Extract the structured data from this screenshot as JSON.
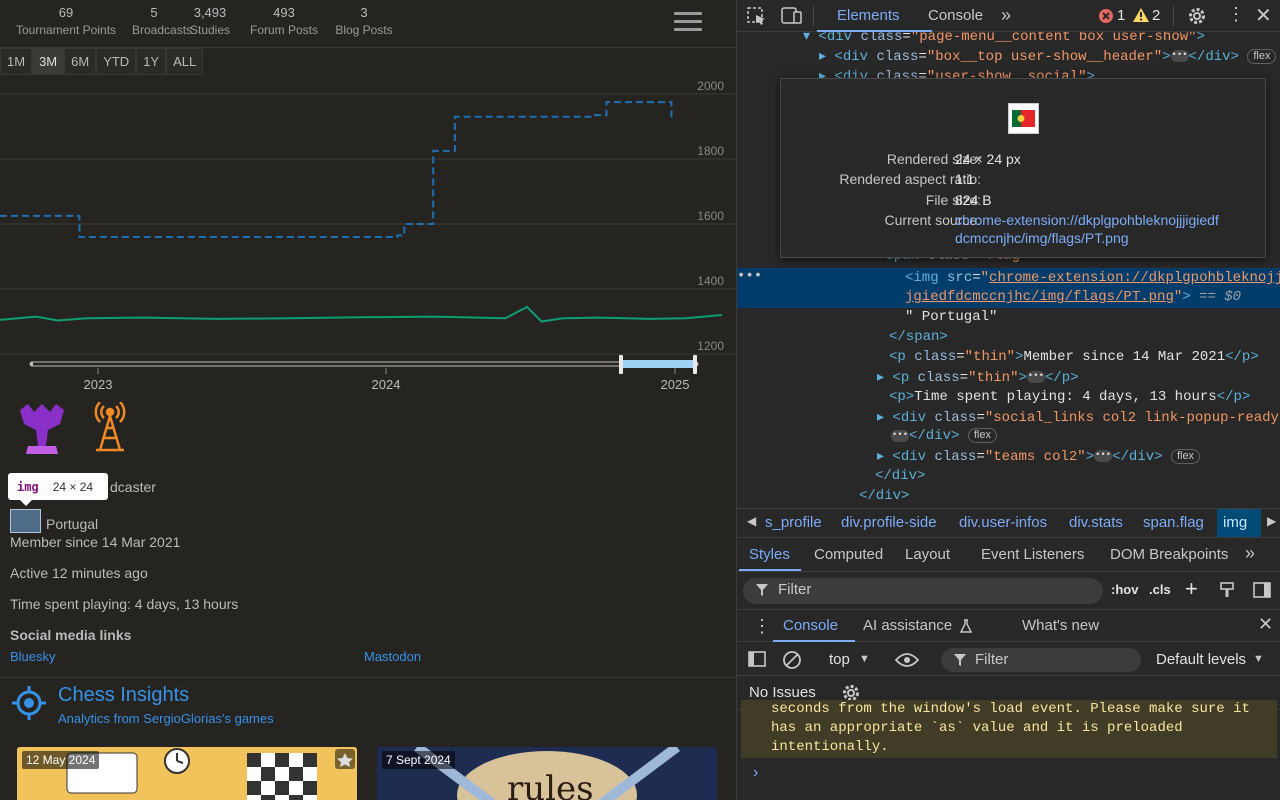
{
  "stats": [
    {
      "num": "69",
      "label": "Tournament Points"
    },
    {
      "num": "5",
      "label": "Broadcasts"
    },
    {
      "num": "3,493",
      "label": "Studies"
    },
    {
      "num": "493",
      "label": "Forum Posts"
    },
    {
      "num": "3",
      "label": "Blog Posts"
    }
  ],
  "ranges": [
    "1M",
    "3M",
    "6M",
    "YTD",
    "1Y",
    "ALL"
  ],
  "selected_range": "3M",
  "chart_data": {
    "type": "line",
    "y_ticks": [
      2000,
      1800,
      1600,
      1400,
      1200
    ],
    "x_ticks": [
      "2023",
      "2024",
      "2025"
    ],
    "ylim": [
      1200,
      2000
    ],
    "series": [
      {
        "style": "dashed",
        "color": "#1f6fb4",
        "x": [
          0,
          0.1,
          0.11,
          0.47,
          0.48,
          0.55,
          0.56,
          0.57,
          0.58,
          0.6,
          0.61,
          0.63,
          0.8,
          0.82,
          0.84,
          0.86,
          0.91,
          0.93
        ],
        "y": [
          1625,
          1625,
          1560,
          1560,
          1560,
          1565,
          1600,
          1600,
          1600,
          1825,
          1825,
          1930,
          1930,
          1935,
          1975,
          1975,
          1975,
          1920
        ]
      },
      {
        "style": "solid",
        "color": "#0f9d75",
        "x": [
          0,
          0.05,
          0.08,
          0.12,
          0.2,
          0.3,
          0.4,
          0.5,
          0.6,
          0.7,
          0.73,
          0.75,
          0.78,
          0.83,
          0.9,
          0.95,
          1.0
        ],
        "y": [
          1305,
          1315,
          1303,
          1310,
          1312,
          1308,
          1310,
          1313,
          1315,
          1310,
          1345,
          1300,
          1310,
          1312,
          1308,
          1310,
          1320
        ]
      }
    ]
  },
  "tooltip": {
    "tag": "img",
    "size": "24 × 24"
  },
  "broadcaster_text": "dcaster",
  "country": "Portugal",
  "member_since": "Member since 14 Mar 2021",
  "active": "Active 12 minutes ago",
  "time_playing": "Time spent playing: 4 days, 13 hours",
  "social_heading": "Social media links",
  "social_links": [
    "Bluesky",
    "Mastodon"
  ],
  "insights": {
    "title": "Chess Insights",
    "subtitle": "Analytics from SergioGlorias's games"
  },
  "cards": [
    {
      "date": "12 May 2024"
    },
    {
      "date": "7 Sept 2024",
      "word": "rules"
    }
  ],
  "devtools": {
    "tabs": [
      "Elements",
      "Console"
    ],
    "errors": "1",
    "warnings": "2",
    "code_lines": [
      {
        "indent": 0,
        "html": "<span class='tag'>▾ &lt;div</span> <span class='attr'>class</span>=<span class='val'>\"page-menu__content box user-show\"</span><span class='tag'>&gt;</span>"
      },
      {
        "indent": 1,
        "html": "<span class='tag'>▸ &lt;div</span> <span class='attr'>class</span>=<span class='val'>\"box__top user-show__header\"</span><span class='tag'>&gt;</span>"
      },
      {
        "indent": 1,
        "html": "<span class='tag'>▸ &lt;div</span> <span class='attr'>class</span>=<span class='val'>\"user-show__social\"</span><span class='tag'>&gt;</span>"
      }
    ],
    "popover": {
      "rendered_size_label": "Rendered size:",
      "rendered_size": "24 × 24 px",
      "aspect_label": "Rendered aspect ratio:",
      "aspect": "1∶1",
      "file_size_label": "File size:",
      "file_size": "824 B",
      "source_label": "Current source:",
      "source_line1": "chrome-extension://dkplgpohbleknojjjigiedf",
      "source_line2": "dcmccnjhc/img/flags/PT.png"
    },
    "lines": {
      "span_flag": "<span class=\"flag\">",
      "img_src_a": "chrome-extension://dkplgpohbleknojjj",
      "img_src_b": "jgiedfdcmccnjhc/img/flags/PT.png",
      "eq": "== $0",
      "portugal_text": "\" Portugal\"",
      "close_span": "</span>",
      "member_p": "Member since 14 Mar 2021",
      "time_p": "Time spent playing: 4 days, 13 hours"
    },
    "breadcrumbs": [
      "s_profile",
      "div.profile-side",
      "div.user-infos",
      "div.stats",
      "span.flag",
      "img"
    ],
    "style_tabs": [
      "Styles",
      "Computed",
      "Layout",
      "Event Listeners",
      "DOM Breakpoints"
    ],
    "filter_placeholder": "Filter",
    "hov": ":hov",
    "cls": ".cls",
    "drawer_tabs": [
      "Console",
      "AI assistance",
      "What's new"
    ],
    "context": "top",
    "levels": "Default levels",
    "no_issues": "No Issues",
    "warning_lines": [
      "seconds from the window's load event. Please make sure it",
      "has an appropriate `as` value and it is preloaded",
      "intentionally."
    ]
  }
}
